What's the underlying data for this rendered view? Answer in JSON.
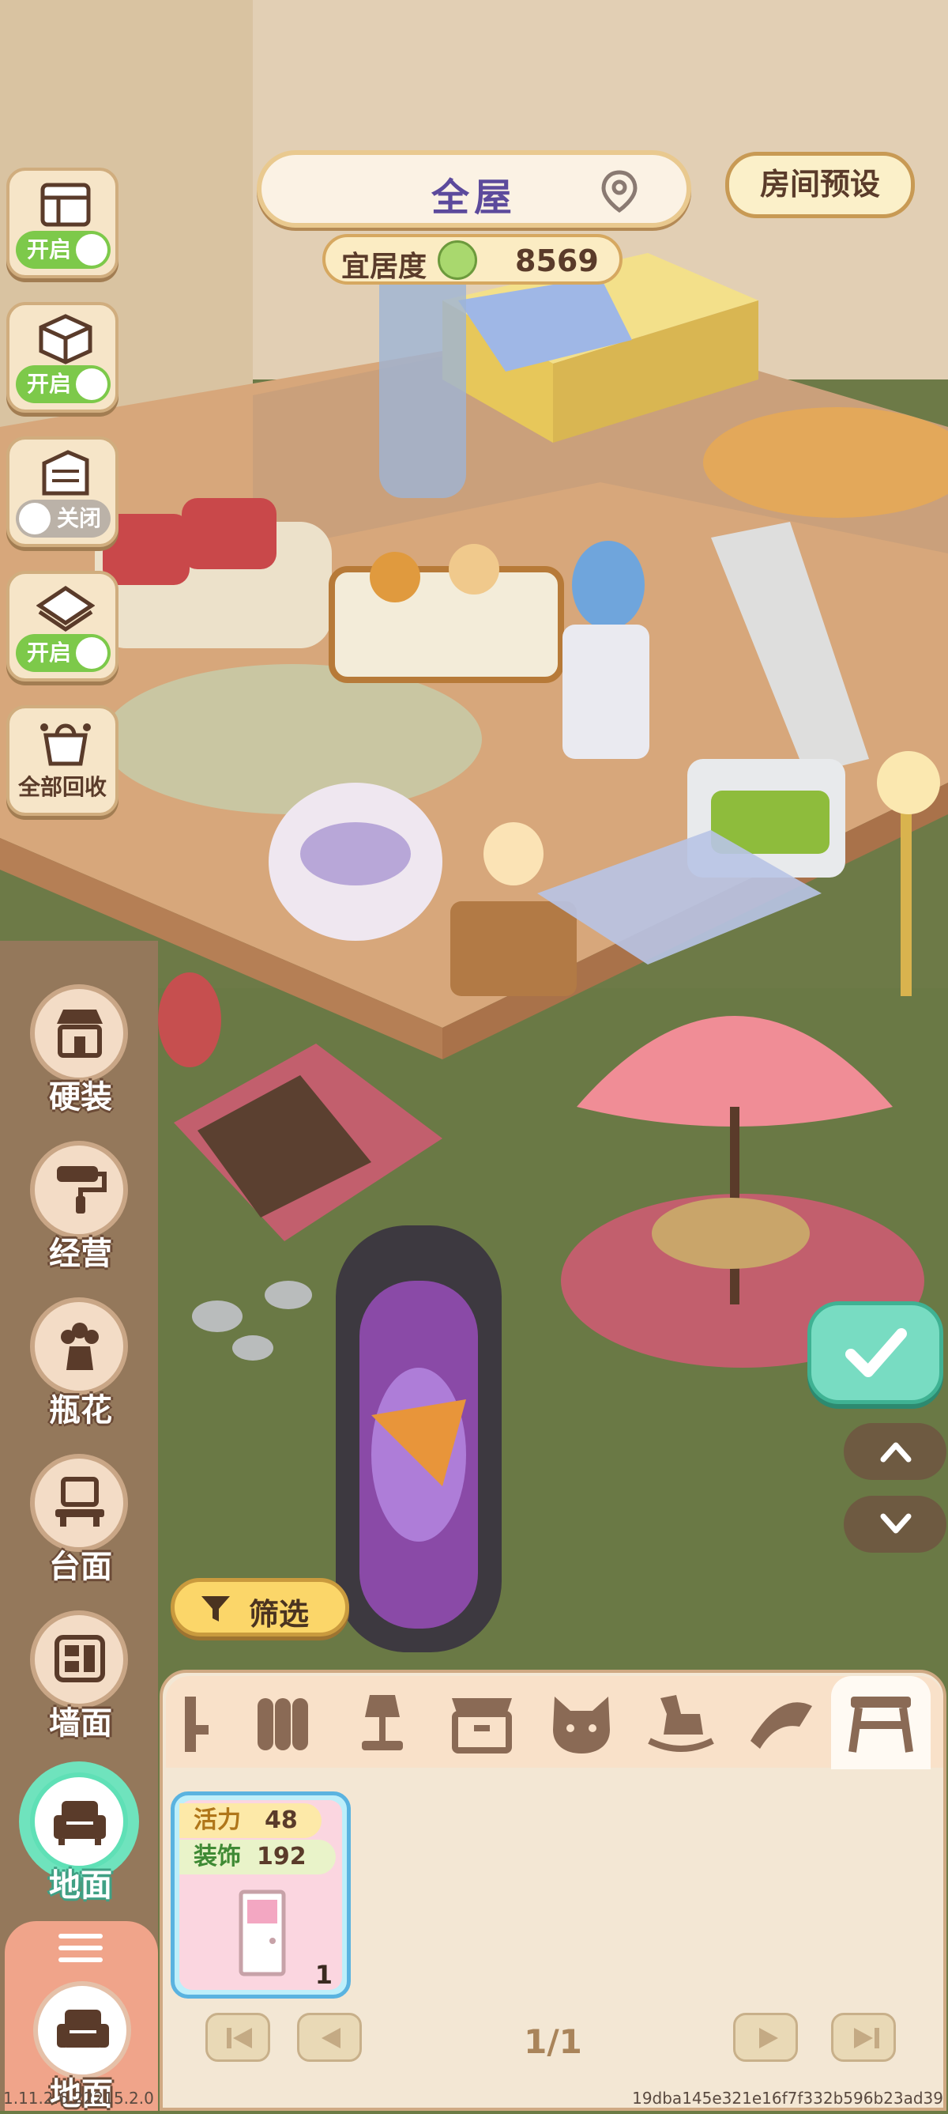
{
  "header": {
    "room_label": "全屋",
    "preset_label": "房间预设",
    "comfort_label": "宜居度",
    "comfort_value": "8569"
  },
  "left_toggles": [
    {
      "icon": "ceiling-icon",
      "state": "开启"
    },
    {
      "icon": "cube-icon",
      "state": "开启"
    },
    {
      "icon": "wall-paper-icon",
      "state": "关闭"
    },
    {
      "icon": "floor-tile-icon",
      "state": "开启"
    }
  ],
  "recycle": {
    "label": "全部回收",
    "icon": "recycle-bag-icon"
  },
  "categories": [
    {
      "label": "硬装",
      "icon": "storefront-icon"
    },
    {
      "label": "经营",
      "icon": "paint-roller-icon"
    },
    {
      "label": "瓶花",
      "icon": "flower-vase-icon"
    },
    {
      "label": "台面",
      "icon": "table-icon"
    },
    {
      "label": "墙面",
      "icon": "wall-shelf-icon"
    },
    {
      "label": "地面",
      "icon": "sofa-icon"
    }
  ],
  "menu_toggle": {
    "label": "地面",
    "icon": "sofa-icon"
  },
  "filter": {
    "label": "筛选",
    "icon": "funnel-icon"
  },
  "tabs": [
    {
      "icon": "chair-icon"
    },
    {
      "icon": "wardrobe-icon"
    },
    {
      "icon": "lamp-icon"
    },
    {
      "icon": "cabinet-icon"
    },
    {
      "icon": "cat-icon"
    },
    {
      "icon": "rocking-horse-icon"
    },
    {
      "icon": "rug-icon"
    },
    {
      "icon": "stool-icon"
    }
  ],
  "item": {
    "stat1_label": "活力",
    "stat1_value": "48",
    "stat2_label": "装饰",
    "stat2_value": "192",
    "count": "1",
    "icon": "door-icon"
  },
  "pager": {
    "page": "1/1"
  },
  "footer": {
    "version": "1.11.2.6.22215.2.0",
    "hash": "19dba145e321e16f7f332b596b23ad39"
  },
  "colors": {
    "accent_mint": "#6fe3bd",
    "switch_on": "#7dc94a",
    "switch_off": "#bbb2a8",
    "sidebar_bg": "#9b785f"
  }
}
